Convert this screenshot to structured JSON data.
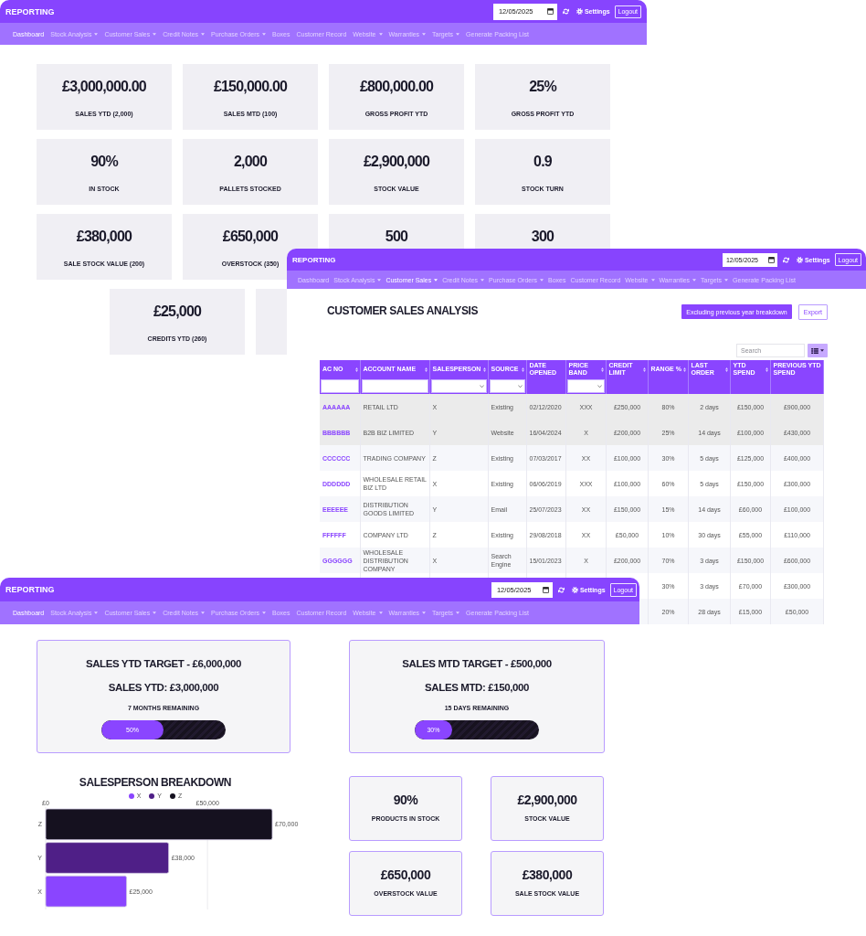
{
  "windows": [
    {
      "kind": "summary",
      "top_bar": {
        "brand": "REPORTING",
        "date": "12/05/2025",
        "settings": "Settings",
        "logout": "Logout"
      },
      "nav": [
        {
          "label": "Dashboard",
          "selected": true,
          "dropdown": false
        },
        {
          "label": "Stock Analysis",
          "selected": false,
          "dropdown": true
        },
        {
          "label": "Customer Sales",
          "selected": false,
          "dropdown": true
        },
        {
          "label": "Credit Notes",
          "selected": false,
          "dropdown": true
        },
        {
          "label": "Purchase Orders",
          "selected": false,
          "dropdown": true
        },
        {
          "label": "Boxes",
          "selected": false,
          "dropdown": false
        },
        {
          "label": "Customer Record",
          "selected": false,
          "dropdown": false
        },
        {
          "label": "Website",
          "selected": false,
          "dropdown": true
        },
        {
          "label": "Warranties",
          "selected": false,
          "dropdown": true
        },
        {
          "label": "Targets",
          "selected": false,
          "dropdown": true
        },
        {
          "label": "Generate Packing List",
          "selected": false,
          "dropdown": false
        }
      ],
      "card_rows": [
        [
          {
            "value": "£3,000,000.00",
            "label": "SALES YTD (2,000)"
          },
          {
            "value": "£150,000.00",
            "label": "SALES MTD (100)"
          },
          {
            "value": "£800,000.00",
            "label": "GROSS PROFIT YTD"
          },
          {
            "value": "25%",
            "label": "GROSS PROFIT YTD"
          }
        ],
        [
          {
            "value": "90%",
            "label": "IN STOCK"
          },
          {
            "value": "2,000",
            "label": "PALLETS STOCKED"
          },
          {
            "value": "£2,900,000",
            "label": "STOCK VALUE"
          },
          {
            "value": "0.9",
            "label": "STOCK TURN"
          }
        ],
        [
          {
            "value": "£380,000",
            "label": "SALE STOCK VALUE (200)"
          },
          {
            "value": "£650,000",
            "label": "OVERSTOCK (350)"
          },
          {
            "value": "500"
          },
          {
            "value": "300"
          }
        ],
        [
          {
            "value": "£25,000",
            "label": "CREDITS YTD (260)"
          },
          {}
        ]
      ]
    },
    {
      "kind": "table_report",
      "top_bar": {
        "brand": "REPORTING",
        "date": "12/05/2025",
        "settings": "Settings",
        "logout": "Logout"
      },
      "nav": [
        {
          "label": "Dashboard",
          "selected": false,
          "dropdown": false
        },
        {
          "label": "Stock Analysis",
          "selected": false,
          "dropdown": true
        },
        {
          "label": "Customer Sales",
          "selected": true,
          "dropdown": true
        },
        {
          "label": "Credit Notes",
          "selected": false,
          "dropdown": true
        },
        {
          "label": "Purchase Orders",
          "selected": false,
          "dropdown": true
        },
        {
          "label": "Boxes",
          "selected": false,
          "dropdown": false
        },
        {
          "label": "Customer Record",
          "selected": false,
          "dropdown": false
        },
        {
          "label": "Website",
          "selected": false,
          "dropdown": true
        },
        {
          "label": "Warranties",
          "selected": false,
          "dropdown": true
        },
        {
          "label": "Targets",
          "selected": false,
          "dropdown": true
        },
        {
          "label": "Generate Packing List",
          "selected": false,
          "dropdown": false
        }
      ],
      "title": "CUSTOMER SALES ANALYSIS",
      "actions": [
        {
          "label": "Excluding previous year breakdown",
          "kind": "primary"
        },
        {
          "label": "Export",
          "kind": "outline"
        }
      ],
      "search": {
        "placeholder": "Search"
      },
      "table": {
        "columns": [
          {
            "label": "AC NO",
            "kind": "link",
            "sortable": true,
            "filter": {
              "kind": "text"
            }
          },
          {
            "label": "ACCOUNT NAME",
            "kind": "text",
            "sortable": true,
            "filter": {
              "kind": "text"
            }
          },
          {
            "label": "SALESPERSON",
            "kind": "text",
            "sortable": true,
            "filter": {
              "kind": "select"
            }
          },
          {
            "label": "SOURCE",
            "kind": "text",
            "sortable": true,
            "filter": {
              "kind": "select"
            }
          },
          {
            "label": "DATE OPENED",
            "kind": "text",
            "sortable": false
          },
          {
            "label": "PRICE BAND",
            "kind": "text",
            "sortable": true,
            "filter": {
              "kind": "select"
            }
          },
          {
            "label": "CREDIT LIMIT",
            "kind": "text",
            "sortable": true
          },
          {
            "label": "RANGE %",
            "kind": "text",
            "sortable": true
          },
          {
            "label": "LAST ORDER",
            "kind": "text",
            "sortable": true
          },
          {
            "label": "YTD SPEND",
            "kind": "text",
            "sortable": true
          },
          {
            "label": "PREVIOUS YTD SPEND",
            "kind": "text",
            "sortable": false
          }
        ],
        "rows": [
          {
            "selected": true,
            "cells": [
              "AAAAAA",
              "RETAIL LTD",
              "X",
              "Existing",
              "02/12/2020",
              "XXX",
              "£250,000",
              "80%",
              "2 days",
              "£150,000",
              "£900,000"
            ]
          },
          {
            "selected": true,
            "cells": [
              "BBBBBB",
              "B2B BIZ LIMITED",
              "Y",
              "Website",
              "16/04/2024",
              "X",
              "£200,000",
              "25%",
              "14 days",
              "£100,000",
              "£430,000"
            ]
          },
          {
            "selected": false,
            "cells": [
              "CCCCCC",
              "TRADING COMPANY",
              "Z",
              "Existing",
              "07/03/2017",
              "XX",
              "£100,000",
              "30%",
              "5 days",
              "£125,000",
              "£400,000"
            ]
          },
          {
            "selected": false,
            "cells": [
              "DDDDDD",
              "WHOLESALE RETAIL BIZ LTD",
              "X",
              "Existing",
              "06/06/2019",
              "XXX",
              "£100,000",
              "60%",
              "5 days",
              "£150,000",
              "£300,000"
            ]
          },
          {
            "selected": false,
            "cells": [
              "EEEEEE",
              "DISTRIBUTION GOODS LIMITED",
              "Y",
              "Email",
              "25/07/2023",
              "XX",
              "£150,000",
              "15%",
              "14 days",
              "£60,000",
              "£100,000"
            ]
          },
          {
            "selected": false,
            "cells": [
              "FFFFFF",
              "COMPANY LTD",
              "Z",
              "Existing",
              "29/08/2018",
              "XX",
              "£50,000",
              "10%",
              "30 days",
              "£55,000",
              "£110,000"
            ]
          },
          {
            "selected": false,
            "cells": [
              "GGGGGG",
              "WHOLESALE DISTRIBUTION COMPANY",
              "X",
              "Search Engine",
              "15/01/2023",
              "X",
              "£200,000",
              "70%",
              "3 days",
              "£150,000",
              "£600,000"
            ]
          },
          {
            "selected": false,
            "cells": [
              "30%",
              "3 days",
              "£70,000",
              "£300,000"
            ]
          },
          {
            "selected": false,
            "cells": [
              "20%",
              "28 days",
              "£15,000",
              "£50,000"
            ]
          }
        ]
      }
    },
    {
      "kind": "targets",
      "top_bar": {
        "brand": "REPORTING",
        "date": "12/05/2025",
        "settings": "Settings",
        "logout": "Logout"
      },
      "nav": [
        {
          "label": "Dashboard",
          "selected": true,
          "dropdown": false
        },
        {
          "label": "Stock Analysis",
          "selected": false,
          "dropdown": true
        },
        {
          "label": "Customer Sales",
          "selected": false,
          "dropdown": true
        },
        {
          "label": "Credit Notes",
          "selected": false,
          "dropdown": true
        },
        {
          "label": "Purchase Orders",
          "selected": false,
          "dropdown": true
        },
        {
          "label": "Boxes",
          "selected": false,
          "dropdown": false
        },
        {
          "label": "Customer Record",
          "selected": false,
          "dropdown": false
        },
        {
          "label": "Website",
          "selected": false,
          "dropdown": true
        },
        {
          "label": "Warranties",
          "selected": false,
          "dropdown": true
        },
        {
          "label": "Targets",
          "selected": false,
          "dropdown": true
        },
        {
          "label": "Generate Packing List",
          "selected": false,
          "dropdown": false
        }
      ],
      "targets": [
        {
          "title": "SALES YTD TARGET - £6,000,000",
          "value": "SALES YTD: £3,000,000",
          "remaining": "7 MONTHS REMAINING",
          "level": 0.5,
          "reading": "50%"
        },
        {
          "title": "SALES MTD TARGET - £500,000",
          "value": "SALES MTD: £150,000",
          "remaining": "15 DAYS REMAINING",
          "level": 0.3,
          "reading": "30%"
        }
      ],
      "chart_data": {
        "type": "bar",
        "orientation": "horizontal",
        "title": "SALESPERSON BREAKDOWN",
        "legend": "top",
        "categories": [
          "Z",
          "Y",
          "X"
        ],
        "series": [
          {
            "name": "X",
            "color": "#8a45ff",
            "values": [
              null,
              null,
              25000
            ]
          },
          {
            "name": "Y",
            "color": "#4f1f87",
            "values": [
              null,
              38000,
              null
            ]
          },
          {
            "name": "Z",
            "color": "#15111f",
            "values": [
              70000,
              null,
              null
            ]
          }
        ],
        "stacked": true,
        "xlim": [
          0,
          70000
        ],
        "xticks": [
          {
            "value": 0,
            "label": "£0"
          },
          {
            "value": 50000,
            "label": "£50,000"
          }
        ],
        "value_labels": [
          "£70,000",
          "£38,000",
          "£25,000"
        ]
      },
      "stats": [
        {
          "value": "90%",
          "label": "PRODUCTS IN STOCK"
        },
        {
          "value": "£2,900,000",
          "label": "STOCK VALUE"
        },
        {
          "value": "£650,000",
          "label": "OVERSTOCK VALUE"
        },
        {
          "value": "£380,000",
          "label": "SALE STOCK VALUE"
        }
      ]
    }
  ]
}
